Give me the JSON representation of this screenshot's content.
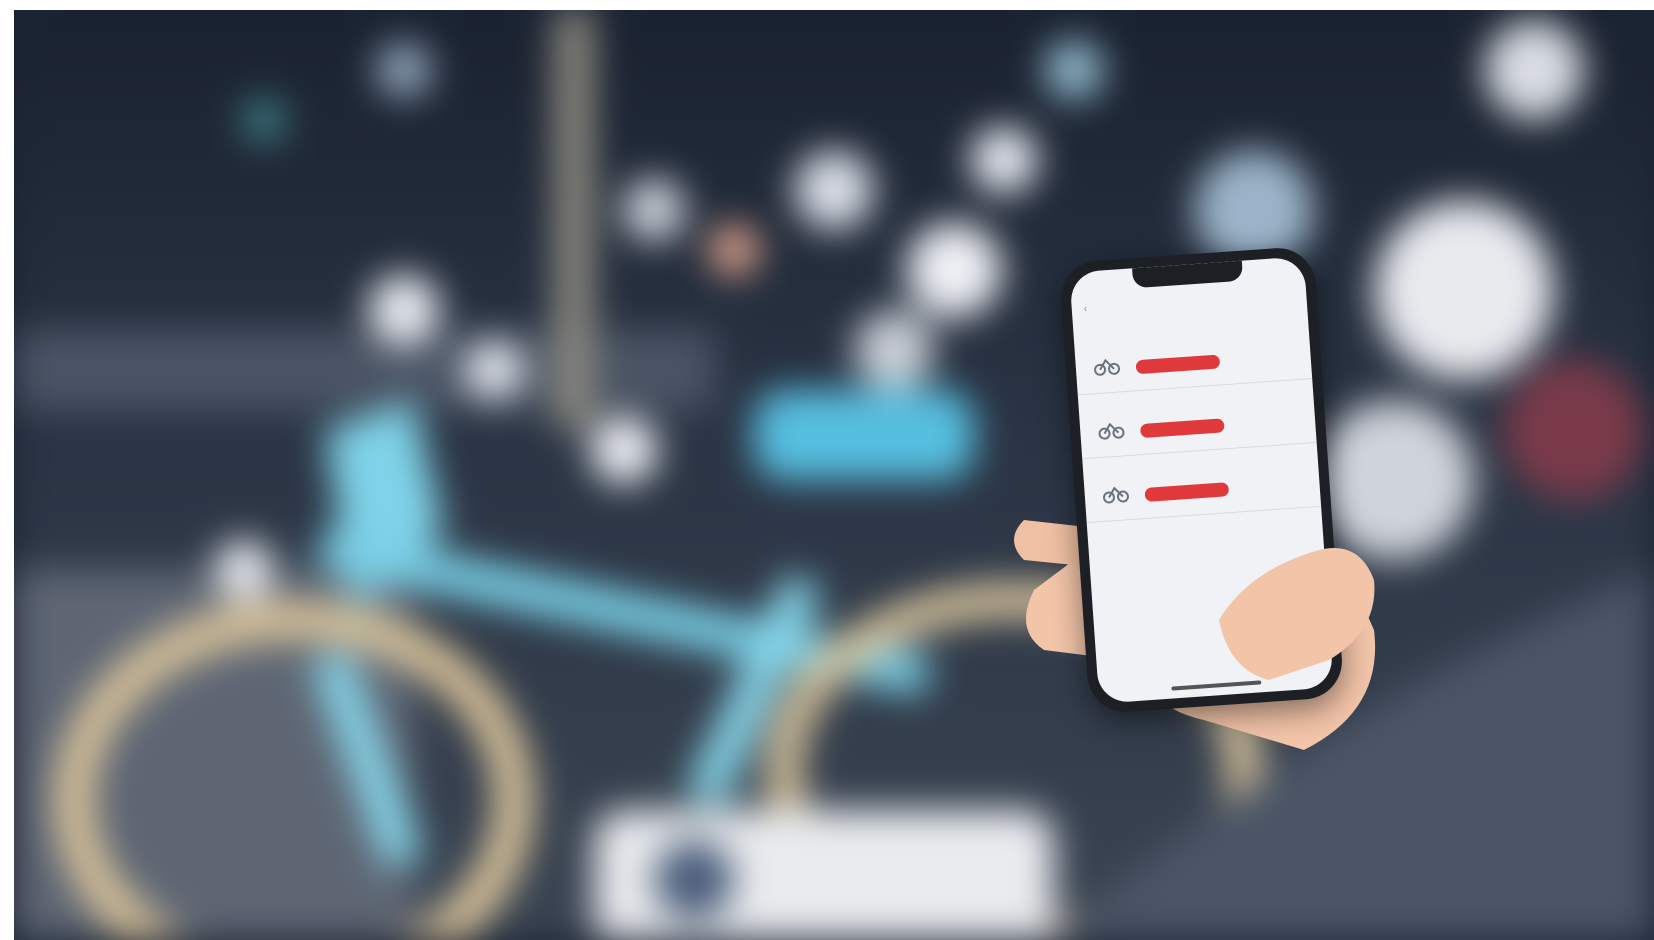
{
  "image": {
    "description_colors": {
      "background_dark": "#1b2433",
      "bike_frame": "#7fd3e8",
      "tire": "#d9c39a",
      "app_accent": "#e0393b",
      "skin": "#f2c4a8"
    }
  },
  "phone_app": {
    "title": "",
    "rows": [
      {
        "name": "",
        "meta": "",
        "button": ""
      },
      {
        "name": "",
        "meta": "",
        "button": ""
      },
      {
        "name": "",
        "meta": "",
        "button": ""
      }
    ]
  }
}
